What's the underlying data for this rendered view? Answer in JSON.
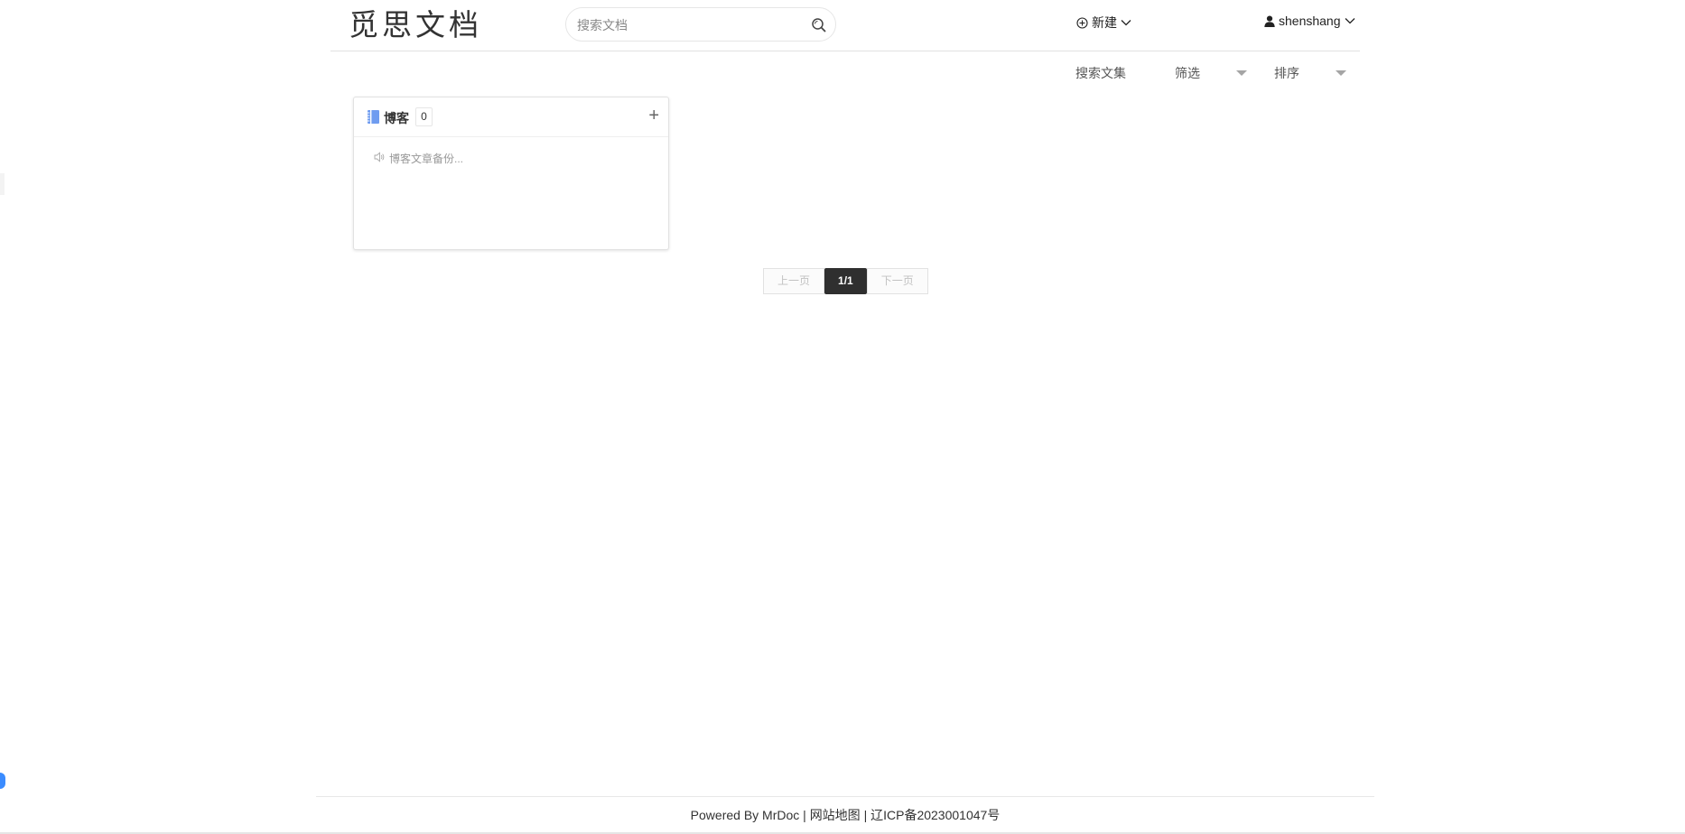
{
  "header": {
    "logo": "觅思文档",
    "search": {
      "placeholder": "搜索文档",
      "value": ""
    },
    "new_label": "新建",
    "username": "shenshang"
  },
  "filters": {
    "search_label": "搜索文集",
    "filter_label": "筛选",
    "sort_label": "排序"
  },
  "projects": [
    {
      "title": "博客",
      "count": "0",
      "add": "+",
      "description": "博客文章备份..."
    }
  ],
  "pagination": {
    "prev_label": "上一页",
    "current": "1/1",
    "next_label": "下一页"
  },
  "footer": {
    "powered": "Powered By MrDoc |",
    "sitemap": "网站地图",
    "separator": "|",
    "icp": "辽ICP备2023001047号"
  },
  "colors": {
    "accent": "#3b8cff",
    "pager_active": "#2f2f2f",
    "book_icon": "#6f9cf0"
  }
}
